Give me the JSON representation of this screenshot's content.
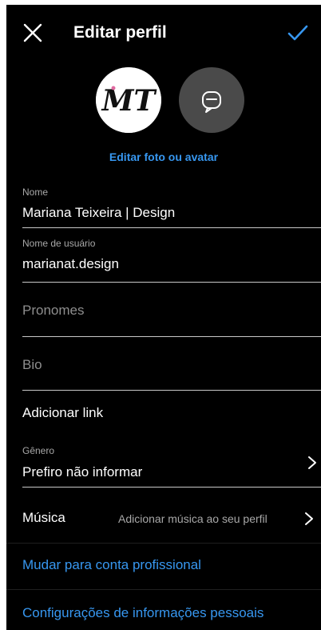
{
  "header": {
    "title": "Editar perfil"
  },
  "avatar": {
    "edit_label": "Editar foto ou avatar",
    "logo_text": "MT"
  },
  "form": {
    "name": {
      "label": "Nome",
      "value": "Mariana Teixeira | Design"
    },
    "username": {
      "label": "Nome de usuário",
      "value": "marianat.design"
    },
    "pronouns": {
      "placeholder": "Pronomes"
    },
    "bio": {
      "placeholder": "Bio"
    },
    "add_link": "Adicionar link",
    "gender": {
      "label": "Gênero",
      "value": "Prefiro não informar"
    },
    "music": {
      "label": "Música",
      "hint": "Adicionar música ao seu perfil"
    }
  },
  "links": {
    "switch_professional": "Mudar para conta profissional",
    "personal_info_settings": "Configurações de informações pessoais"
  },
  "colors": {
    "background": "#000000",
    "accent": "#3797f0",
    "secondary_text": "#a8a8a8"
  },
  "icons": {
    "close": "close-icon",
    "confirm": "checkmark-icon",
    "chevron": "chevron-right-icon",
    "avatar_alt": "avatar-sticker-icon"
  }
}
